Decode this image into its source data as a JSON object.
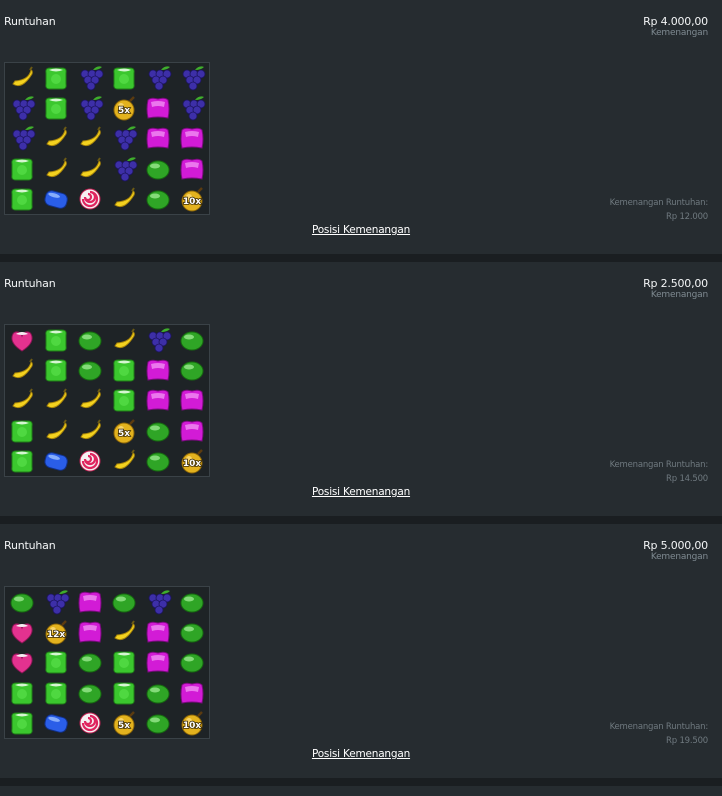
{
  "panels": [
    {
      "title": "Runtuhan",
      "amount": "Rp 4.000,00",
      "amount_label": "Kemenangan",
      "tumble_win_label": "Kemenangan Runtuhan:",
      "tumble_win_value": "Rp 12.000",
      "link": "Posisi Kemenangan",
      "grid": [
        [
          "banana",
          "green-square",
          "grape",
          "green-square",
          "grape",
          "grape"
        ],
        [
          "grape",
          "green-square",
          "grape",
          "bomb",
          "purple-square",
          "grape"
        ],
        [
          "grape",
          "banana",
          "banana",
          "grape",
          "purple-square",
          "purple-square"
        ],
        [
          "green-square",
          "banana",
          "banana",
          "grape",
          "green-round",
          "purple-square"
        ],
        [
          "green-square",
          "blue-candy",
          "lollipop",
          "banana",
          "green-round",
          "bomb"
        ]
      ],
      "multipliers": [
        {
          "row": 1,
          "col": 3,
          "text": "5x"
        },
        {
          "row": 4,
          "col": 5,
          "text": "10x"
        }
      ]
    },
    {
      "title": "Runtuhan",
      "amount": "Rp 2.500,00",
      "amount_label": "Kemenangan",
      "tumble_win_label": "Kemenangan Runtuhan:",
      "tumble_win_value": "Rp 14.500",
      "link": "Posisi Kemenangan",
      "grid": [
        [
          "heart",
          "green-square",
          "green-round",
          "banana",
          "grape",
          "green-round"
        ],
        [
          "banana",
          "green-square",
          "green-round",
          "green-square",
          "purple-square",
          "green-round"
        ],
        [
          "banana",
          "banana",
          "banana",
          "green-square",
          "purple-square",
          "purple-square"
        ],
        [
          "green-square",
          "banana",
          "banana",
          "bomb",
          "green-round",
          "purple-square"
        ],
        [
          "green-square",
          "blue-candy",
          "lollipop",
          "banana",
          "green-round",
          "bomb"
        ]
      ],
      "multipliers": [
        {
          "row": 3,
          "col": 3,
          "text": "5x"
        },
        {
          "row": 4,
          "col": 5,
          "text": "10x"
        }
      ]
    },
    {
      "title": "Runtuhan",
      "amount": "Rp 5.000,00",
      "amount_label": "Kemenangan",
      "tumble_win_label": "Kemenangan Runtuhan:",
      "tumble_win_value": "Rp 19.500",
      "link": "Posisi Kemenangan",
      "grid": [
        [
          "green-round",
          "grape",
          "purple-square",
          "green-round",
          "grape",
          "green-round"
        ],
        [
          "heart",
          "bomb",
          "purple-square",
          "banana",
          "purple-square",
          "green-round"
        ],
        [
          "heart",
          "green-square",
          "green-round",
          "green-square",
          "purple-square",
          "green-round"
        ],
        [
          "green-square",
          "green-square",
          "green-round",
          "green-square",
          "green-round",
          "purple-square"
        ],
        [
          "green-square",
          "blue-candy",
          "lollipop",
          "bomb",
          "green-round",
          "bomb"
        ]
      ],
      "multipliers": [
        {
          "row": 1,
          "col": 1,
          "text": "12x"
        },
        {
          "row": 4,
          "col": 3,
          "text": "5x"
        },
        {
          "row": 4,
          "col": 5,
          "text": "10x"
        }
      ]
    }
  ]
}
